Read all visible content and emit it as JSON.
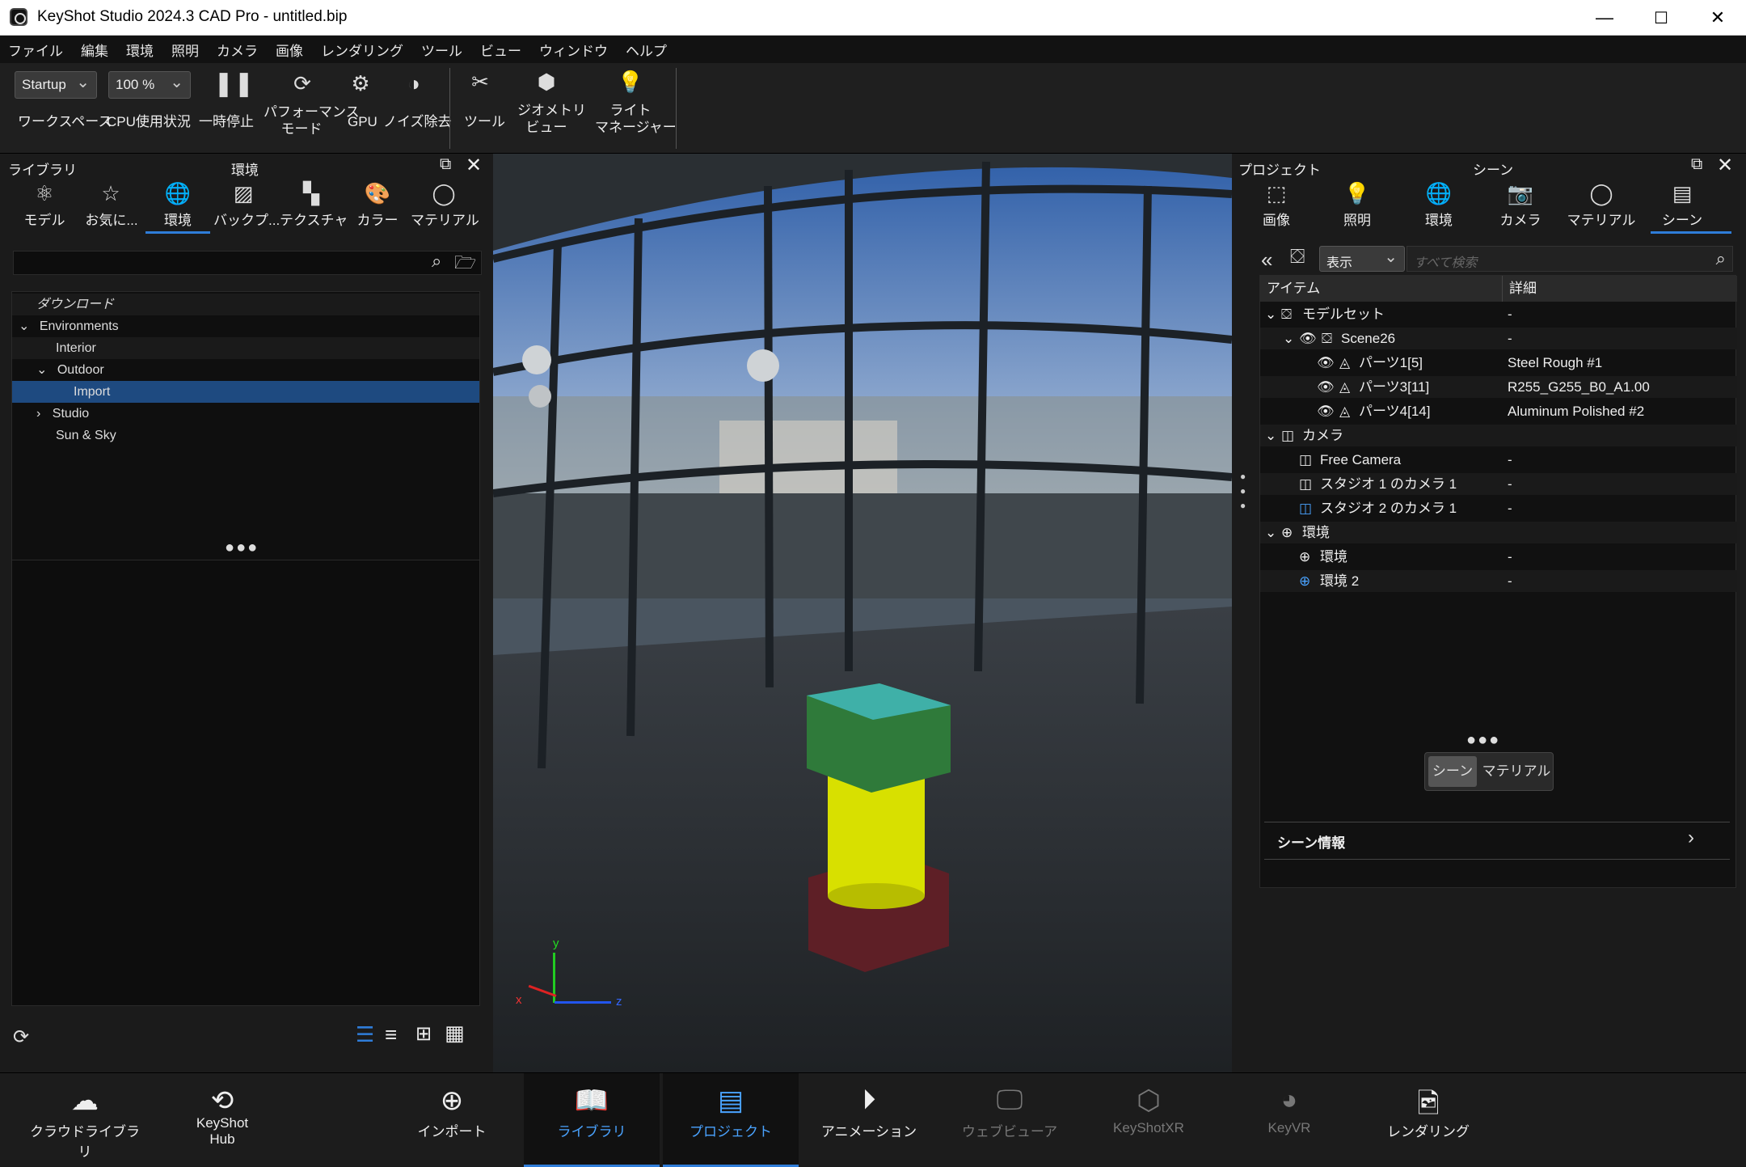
{
  "window": {
    "title": "KeyShot Studio 2024.3 CAD Pro - untitled.bip",
    "minimize": "—",
    "maximize": "☐",
    "close": "✕"
  },
  "menu": [
    "ファイル",
    "編集",
    "環境",
    "照明",
    "カメラ",
    "画像",
    "レンダリング",
    "ツール",
    "ビュー",
    "ウィンドウ",
    "ヘルプ"
  ],
  "toolbar": {
    "workspace_value": "Startup",
    "workspace_label": "ワークスペース",
    "cpu_value": "100 %",
    "cpu_label": "CPU使用状況",
    "pause_label": "一時停止",
    "perf_label1": "パフォーマンス",
    "perf_label2": "モード",
    "gpu_label": "GPU",
    "denoise_label": "ノイズ除去",
    "tool_label": "ツール",
    "geo_label1": "ジオメトリ",
    "geo_label2": "ビュー",
    "light_label1": "ライト",
    "light_label2": "マネージャー"
  },
  "library": {
    "title": "ライブラリ",
    "section": "環境",
    "tabs": [
      "モデル",
      "お気に...",
      "環境",
      "バックプ...",
      "テクスチャ",
      "カラー",
      "マテリアル"
    ],
    "tree": {
      "download": "ダウンロード",
      "environments": "Environments",
      "interior": "Interior",
      "outdoor": "Outdoor",
      "import": "Import",
      "studio": "Studio",
      "sunsky": "Sun & Sky"
    }
  },
  "project": {
    "title": "プロジェクト",
    "section": "シーン",
    "tabs": [
      "画像",
      "照明",
      "環境",
      "カメラ",
      "マテリアル",
      "シーン"
    ],
    "filter_value": "表示",
    "search_placeholder": "すべて検索",
    "col_item": "アイテム",
    "col_detail": "詳細",
    "rows": [
      {
        "name": "モデルセット",
        "detail": "-"
      },
      {
        "name": "Scene26",
        "detail": "-"
      },
      {
        "name": "パーツ1[5]",
        "detail": "Steel Rough #1"
      },
      {
        "name": "パーツ3[11]",
        "detail": "R255_G255_B0_A1.00"
      },
      {
        "name": "パーツ4[14]",
        "detail": "Aluminum Polished #2"
      },
      {
        "name": "カメラ",
        "detail": ""
      },
      {
        "name": "Free Camera",
        "detail": "-"
      },
      {
        "name": "スタジオ 1 のカメラ 1",
        "detail": "-"
      },
      {
        "name": "スタジオ 2 のカメラ 1",
        "detail": "-"
      },
      {
        "name": "環境",
        "detail": ""
      },
      {
        "name": "環境",
        "detail": "-"
      },
      {
        "name": "環境 2",
        "detail": "-"
      }
    ],
    "toggle_scene": "シーン",
    "toggle_material": "マテリアル",
    "scene_info": "シーン情報"
  },
  "axes": {
    "x": "x",
    "y": "y",
    "z": "z"
  },
  "bottombar": [
    {
      "label": "クラウドライブラリ",
      "label2": ""
    },
    {
      "label": "KeyShot",
      "label2": "Hub"
    },
    {
      "label": "インポート",
      "label2": ""
    },
    {
      "label": "ライブラリ",
      "label2": ""
    },
    {
      "label": "プロジェクト",
      "label2": ""
    },
    {
      "label": "アニメーション",
      "label2": ""
    },
    {
      "label": "ウェブビューア",
      "label2": ""
    },
    {
      "label": "KeyShotXR",
      "label2": ""
    },
    {
      "label": "KeyVR",
      "label2": ""
    },
    {
      "label": "レンダリング",
      "label2": ""
    }
  ]
}
